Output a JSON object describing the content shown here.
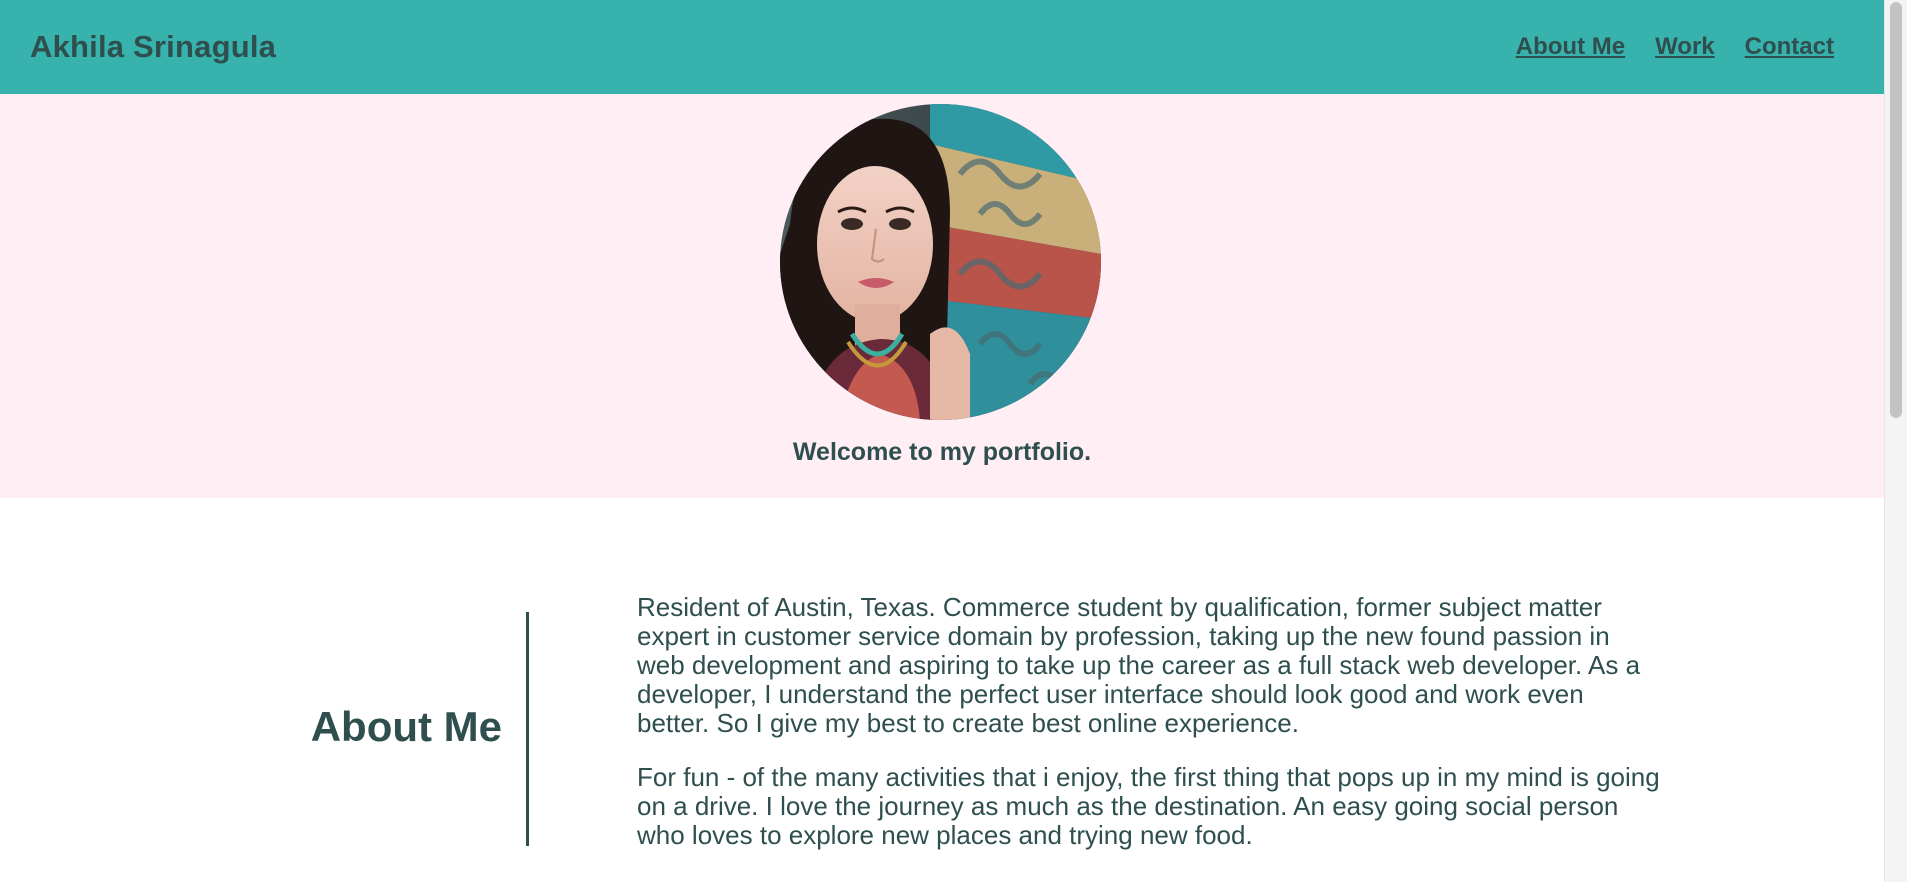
{
  "header": {
    "brand": "Akhila Srinagula",
    "nav": [
      {
        "label": "About Me"
      },
      {
        "label": "Work"
      },
      {
        "label": "Contact"
      }
    ]
  },
  "hero": {
    "welcome": "Welcome to my portfolio."
  },
  "about": {
    "title": "About Me",
    "paragraphs": [
      "Resident of Austin, Texas. Commerce student by qualification, former subject matter expert in customer service domain by profession, taking up the new found passion in web development and aspiring to take up the career as a full stack web developer. As a developer, I understand the perfect user interface should look good and work even better. So I give my best to create best online experience.",
      "For fun - of the many activities that i enjoy, the first thing that pops up in my mind is going on a drive. I love the journey as much as the destination. An easy going social person who loves to explore new places and trying new food."
    ]
  },
  "colors": {
    "header_bg": "#38b2ac",
    "hero_bg": "#ffeef4",
    "text": "#2f4f4f"
  }
}
